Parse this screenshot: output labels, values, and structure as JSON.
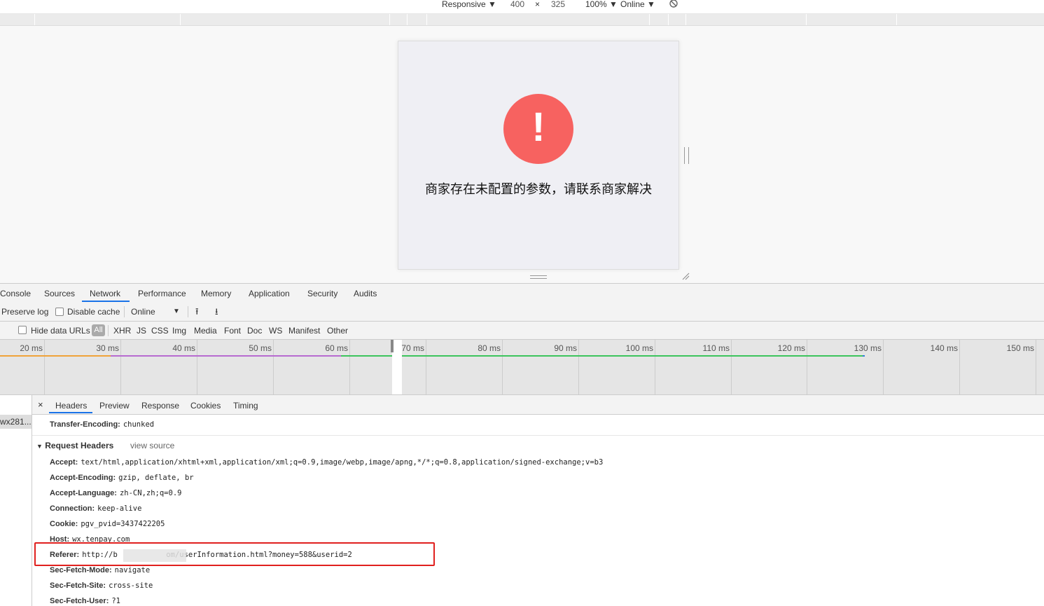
{
  "device_toolbar": {
    "mode": "Responsive",
    "width": "400",
    "times": "×",
    "height": "325",
    "zoom": "100%",
    "network": "Online",
    "caret": "▼",
    "rotate_icon": "rotate-icon"
  },
  "page": {
    "error_icon_glyph": "!",
    "error_message": "商家存在未配置的参数，请联系商家解决",
    "error_color": "#f76260"
  },
  "devtools": {
    "tabs": [
      "Console",
      "Sources",
      "Network",
      "Performance",
      "Memory",
      "Application",
      "Security",
      "Audits"
    ],
    "active_tab": "Network"
  },
  "network_toolbar": {
    "preserve_log": "Preserve log",
    "disable_cache": "Disable cache",
    "throttle": "Online",
    "caret": "▼",
    "upload_icon": "⭱",
    "download_icon": "⭳"
  },
  "filter_bar": {
    "hide_data_urls": "Hide data URLs",
    "types": [
      "All",
      "XHR",
      "JS",
      "CSS",
      "Img",
      "Media",
      "Font",
      "Doc",
      "WS",
      "Manifest",
      "Other"
    ]
  },
  "overview": {
    "ticks": [
      "20 ms",
      "30 ms",
      "40 ms",
      "50 ms",
      "60 ms",
      "70 ms",
      "80 ms",
      "90 ms",
      "100 ms",
      "110 ms",
      "120 ms",
      "130 ms",
      "140 ms",
      "150 ms"
    ]
  },
  "request_list": {
    "selected": "wx281..."
  },
  "detail": {
    "close": "×",
    "tabs": [
      "Headers",
      "Preview",
      "Response",
      "Cookies",
      "Timing"
    ],
    "active_tab": "Headers",
    "transfer_encoding": {
      "name": "Transfer-Encoding:",
      "value": "chunked"
    },
    "section_title": "Request Headers",
    "section_toggle": "▼",
    "view_source": "view source",
    "request_headers": [
      {
        "name": "Accept:",
        "value": "text/html,application/xhtml+xml,application/xml;q=0.9,image/webp,image/apng,*/*;q=0.8,application/signed-exchange;v=b3"
      },
      {
        "name": "Accept-Encoding:",
        "value": "gzip, deflate, br"
      },
      {
        "name": "Accept-Language:",
        "value": "zh-CN,zh;q=0.9"
      },
      {
        "name": "Connection:",
        "value": "keep-alive"
      },
      {
        "name": "Cookie:",
        "value": "pgv_pvid=3437422205"
      },
      {
        "name": "Host:",
        "value": "wx.tenpay.com"
      },
      {
        "name": "Referer:",
        "value": "http://b           om/userInformation.html?money=588&userid=2"
      },
      {
        "name": "Sec-Fetch-Mode:",
        "value": "navigate"
      },
      {
        "name": "Sec-Fetch-Site:",
        "value": "cross-site"
      },
      {
        "name": "Sec-Fetch-User:",
        "value": "?1"
      }
    ],
    "highlight_color": "#e0201e"
  }
}
